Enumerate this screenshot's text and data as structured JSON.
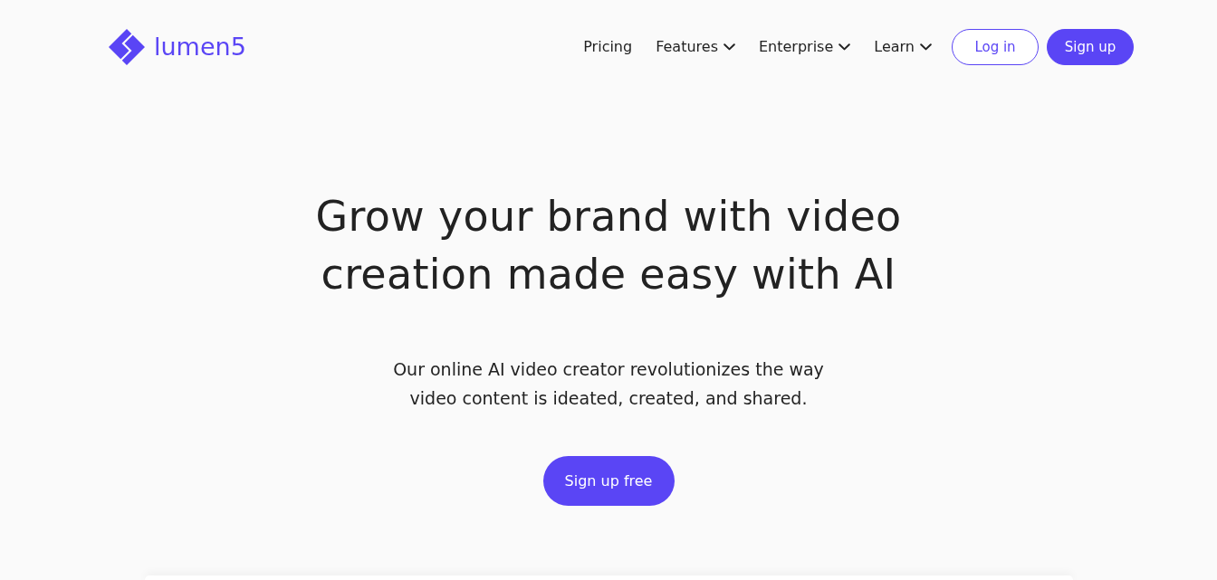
{
  "brand": {
    "name": "lumen5"
  },
  "nav": {
    "items": [
      {
        "label": "Pricing",
        "kind": "link"
      },
      {
        "label": "Features",
        "kind": "dropdown"
      },
      {
        "label": "Enterprise",
        "kind": "dropdown"
      },
      {
        "label": "Learn",
        "kind": "dropdown"
      }
    ],
    "buttons": [
      {
        "label": "Log in",
        "kind": "outline"
      },
      {
        "label": "Sign up",
        "kind": "filled"
      }
    ]
  },
  "hero": {
    "title": "Grow your brand with video creation made easy with AI",
    "subtitle": "Our online AI video creator revolutionizes the way video content is ideated, created, and shared.",
    "cta": {
      "label": "Sign up free"
    }
  }
}
